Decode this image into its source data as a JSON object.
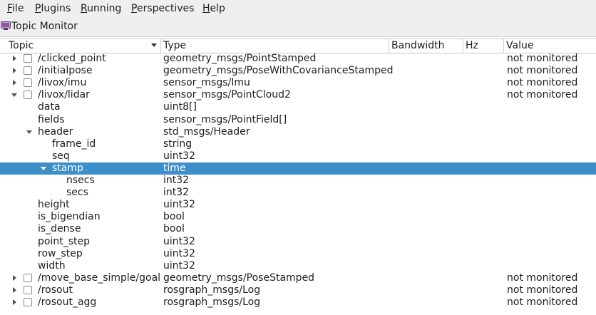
{
  "menu": [
    {
      "label": "File",
      "mnemonic": "F",
      "rest": "ile"
    },
    {
      "label": "Plugins",
      "mnemonic": "P",
      "rest": "lugins"
    },
    {
      "label": "Running",
      "mnemonic": "R",
      "rest": "unning"
    },
    {
      "label": "Perspectives",
      "mnemonic": "P",
      "rest": "erspectives"
    },
    {
      "label": "Help",
      "mnemonic": "H",
      "rest": "elp"
    }
  ],
  "window": {
    "title": "Topic Monitor",
    "icon": "monitor-icon"
  },
  "columns": [
    "Topic",
    "Type",
    "Bandwidth",
    "Hz",
    "Value"
  ],
  "rows": [
    {
      "level": 0,
      "expander": "collapsed",
      "checkbox": true,
      "topic": "/clicked_point",
      "type": "geometry_msgs/PointStamped",
      "bandwidth": "",
      "hz": "",
      "value": "not monitored"
    },
    {
      "level": 0,
      "expander": "collapsed",
      "checkbox": true,
      "topic": "/initialpose",
      "type": "geometry_msgs/PoseWithCovarianceStamped",
      "bandwidth": "",
      "hz": "",
      "value": "not monitored"
    },
    {
      "level": 0,
      "expander": "collapsed",
      "checkbox": true,
      "topic": "/livox/imu",
      "type": "sensor_msgs/Imu",
      "bandwidth": "",
      "hz": "",
      "value": "not monitored"
    },
    {
      "level": 0,
      "expander": "expanded",
      "checkbox": true,
      "topic": "/livox/lidar",
      "type": "sensor_msgs/PointCloud2",
      "bandwidth": "",
      "hz": "",
      "value": "not monitored"
    },
    {
      "level": 1,
      "expander": "none",
      "checkbox": false,
      "topic": "data",
      "type": "uint8[]",
      "bandwidth": "",
      "hz": "",
      "value": ""
    },
    {
      "level": 1,
      "expander": "none",
      "checkbox": false,
      "topic": "fields",
      "type": "sensor_msgs/PointField[]",
      "bandwidth": "",
      "hz": "",
      "value": ""
    },
    {
      "level": 1,
      "expander": "expanded",
      "checkbox": false,
      "topic": "header",
      "type": "std_msgs/Header",
      "bandwidth": "",
      "hz": "",
      "value": ""
    },
    {
      "level": 2,
      "expander": "none",
      "checkbox": false,
      "topic": "frame_id",
      "type": "string",
      "bandwidth": "",
      "hz": "",
      "value": ""
    },
    {
      "level": 2,
      "expander": "none",
      "checkbox": false,
      "topic": "seq",
      "type": "uint32",
      "bandwidth": "",
      "hz": "",
      "value": ""
    },
    {
      "level": 2,
      "expander": "expanded",
      "checkbox": false,
      "topic": "stamp",
      "type": "time",
      "bandwidth": "",
      "hz": "",
      "value": "",
      "selected": true
    },
    {
      "level": 3,
      "expander": "none",
      "checkbox": false,
      "topic": "nsecs",
      "type": "int32",
      "bandwidth": "",
      "hz": "",
      "value": ""
    },
    {
      "level": 3,
      "expander": "none",
      "checkbox": false,
      "topic": "secs",
      "type": "int32",
      "bandwidth": "",
      "hz": "",
      "value": ""
    },
    {
      "level": 1,
      "expander": "none",
      "checkbox": false,
      "topic": "height",
      "type": "uint32",
      "bandwidth": "",
      "hz": "",
      "value": ""
    },
    {
      "level": 1,
      "expander": "none",
      "checkbox": false,
      "topic": "is_bigendian",
      "type": "bool",
      "bandwidth": "",
      "hz": "",
      "value": ""
    },
    {
      "level": 1,
      "expander": "none",
      "checkbox": false,
      "topic": "is_dense",
      "type": "bool",
      "bandwidth": "",
      "hz": "",
      "value": ""
    },
    {
      "level": 1,
      "expander": "none",
      "checkbox": false,
      "topic": "point_step",
      "type": "uint32",
      "bandwidth": "",
      "hz": "",
      "value": ""
    },
    {
      "level": 1,
      "expander": "none",
      "checkbox": false,
      "topic": "row_step",
      "type": "uint32",
      "bandwidth": "",
      "hz": "",
      "value": ""
    },
    {
      "level": 1,
      "expander": "none",
      "checkbox": false,
      "topic": "width",
      "type": "uint32",
      "bandwidth": "",
      "hz": "",
      "value": ""
    },
    {
      "level": 0,
      "expander": "collapsed",
      "checkbox": true,
      "topic": "/move_base_simple/goal",
      "type": "geometry_msgs/PoseStamped",
      "bandwidth": "",
      "hz": "",
      "value": "not monitored"
    },
    {
      "level": 0,
      "expander": "collapsed",
      "checkbox": true,
      "topic": "/rosout",
      "type": "rosgraph_msgs/Log",
      "bandwidth": "",
      "hz": "",
      "value": "not monitored"
    },
    {
      "level": 0,
      "expander": "collapsed",
      "checkbox": true,
      "topic": "/rosout_agg",
      "type": "rosgraph_msgs/Log",
      "bandwidth": "",
      "hz": "",
      "value": "not monitored"
    }
  ],
  "colors": {
    "selection": "#3d8ec9",
    "chrome": "#efefef"
  }
}
